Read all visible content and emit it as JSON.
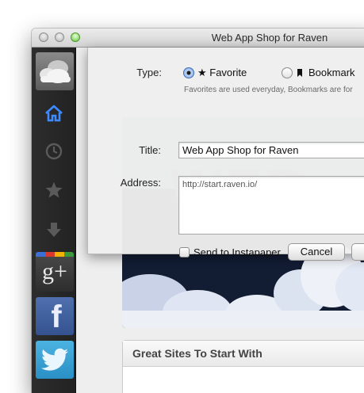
{
  "window": {
    "title": "Web App Shop for Raven"
  },
  "addressbar": {
    "url": "http://start.raven.io"
  },
  "sidebar": {
    "items": [
      {
        "icon": "weather-cloud-icon"
      },
      {
        "icon": "home-icon",
        "active": true
      },
      {
        "icon": "clock-icon"
      },
      {
        "icon": "star-icon"
      },
      {
        "icon": "download-icon"
      },
      {
        "icon": "google-plus-icon",
        "label": "g+"
      },
      {
        "icon": "facebook-icon",
        "label": "f"
      },
      {
        "icon": "twitter-icon"
      }
    ],
    "colors": {
      "active": "#3d8bff",
      "inactive": "#5a5a5a"
    }
  },
  "dialog": {
    "type_label": "Type:",
    "favorite_label": "★ Favorite",
    "bookmark_label": "Bookmark",
    "selected_type": "Favorite",
    "hint": "Favorites are used everyday, Bookmarks are for",
    "title_label": "Title:",
    "title_value": "Web App Shop for Raven",
    "address_label": "Address:",
    "address_value": "http://start.raven.io/",
    "instapaper_label": "Send to Instapaper",
    "instapaper_checked": false,
    "cancel_label": "Cancel"
  },
  "main": {
    "great_sites_heading": "Great Sites To Start With"
  }
}
